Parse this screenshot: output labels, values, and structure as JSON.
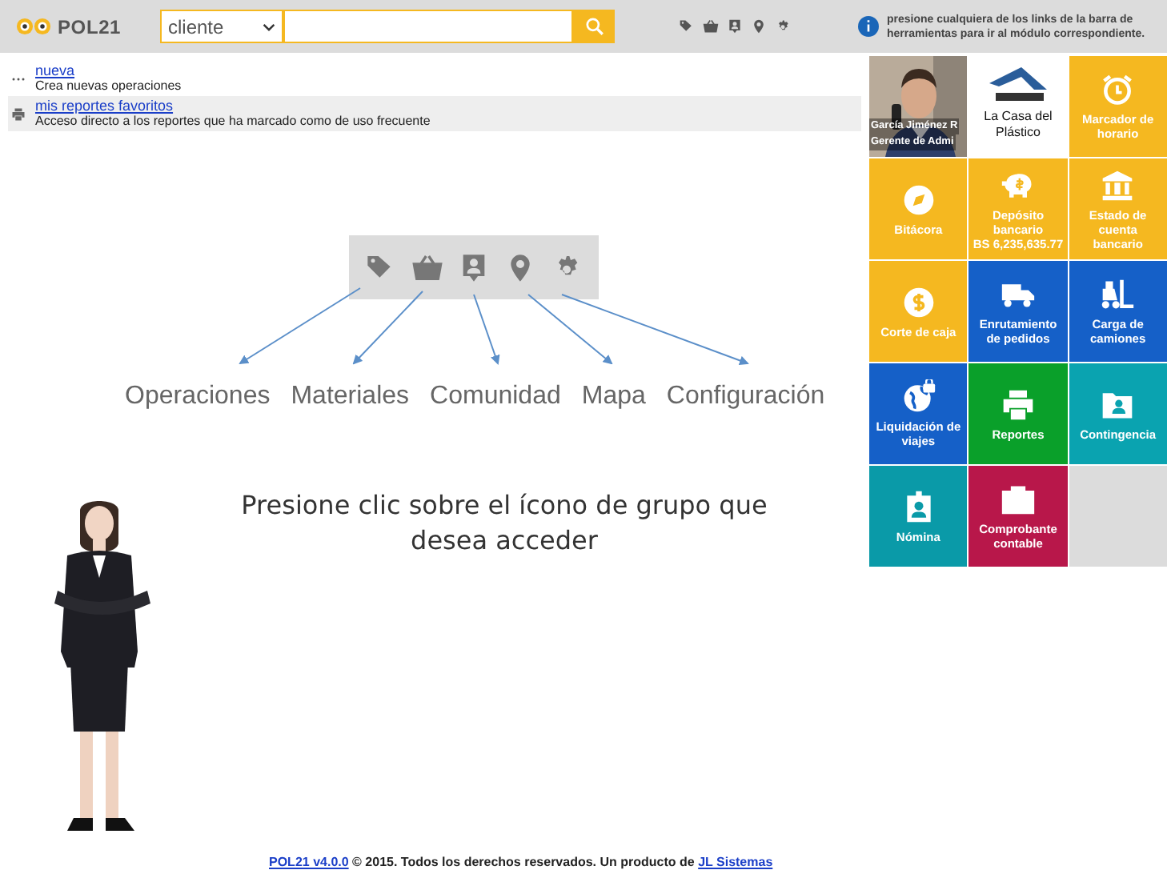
{
  "header": {
    "logo": "POL21",
    "search": {
      "category": "cliente"
    },
    "info": "presione cualquiera de los links de la barra de herramientas para ir al módulo correspondiente."
  },
  "links": [
    {
      "title": "nueva",
      "description": "Crea nuevas operaciones",
      "selected": false
    },
    {
      "title": "mis reportes favoritos",
      "description": "Acceso directo a los reportes que ha marcado como de uso frecuente",
      "selected": true
    }
  ],
  "groups": [
    {
      "label": "Operaciones"
    },
    {
      "label": "Materiales"
    },
    {
      "label": "Comunidad"
    },
    {
      "label": "Mapa"
    },
    {
      "label": "Configuración"
    }
  ],
  "instruction": "Presione clic sobre el ícono de grupo que desea acceder",
  "tiles": [
    {
      "lines": [
        "García Jiménez R",
        "Gerente de Admi"
      ]
    },
    {
      "kind": "logo",
      "lines": [
        "La Casa del Plástico"
      ]
    },
    {
      "kind": "icon",
      "color": "#f5b820",
      "lines": [
        "Marcador de horario"
      ]
    },
    {
      "kind": "icon",
      "color": "#f5b820",
      "lines": [
        "Bitácora"
      ]
    },
    {
      "kind": "icon",
      "color": "#f5b820",
      "lines": [
        "Depósito bancario",
        "BS 6,235,635.77"
      ]
    },
    {
      "kind": "icon",
      "color": "#f5b820",
      "lines": [
        "Estado de cuenta bancario"
      ]
    },
    {
      "kind": "icon",
      "color": "#f5b820",
      "lines": [
        "Corte de caja"
      ]
    },
    {
      "kind": "icon",
      "color": "#1560c8",
      "lines": [
        "Enrutamiento de pedidos"
      ]
    },
    {
      "kind": "icon",
      "color": "#1560c8",
      "lines": [
        "Carga de camiones"
      ]
    },
    {
      "kind": "icon",
      "color": "#1560c8",
      "lines": [
        "Liquidación de viajes"
      ]
    },
    {
      "kind": "icon",
      "color": "#0aa02a",
      "lines": [
        "Reportes"
      ]
    },
    {
      "kind": "icon",
      "color": "#0aa3b0",
      "lines": [
        "Contingencia"
      ]
    },
    {
      "kind": "icon",
      "color": "#0a9aa8",
      "lines": [
        "Nómina"
      ]
    },
    {
      "kind": "icon",
      "color": "#b8174a",
      "lines": [
        "Comprobante contable"
      ]
    },
    {
      "kind": "empty"
    }
  ],
  "footer": {
    "product": "POL21 v4.0.0",
    "text": "© 2015. Todos los derechos reservados. Un producto de",
    "company": "JL Sistemas"
  }
}
